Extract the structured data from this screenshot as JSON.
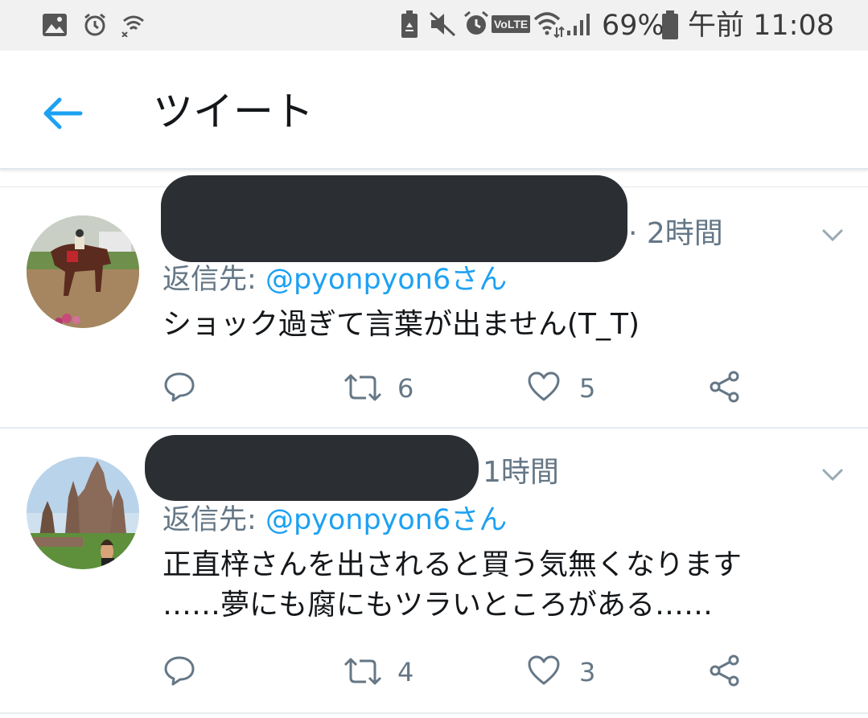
{
  "status_bar": {
    "left_icons": [
      "image-icon",
      "alarm-icon",
      "wifi-off-icon"
    ],
    "right_icons": [
      "recycle-battery-icon",
      "mute-icon",
      "alarm-clock-icon",
      "volte-icon",
      "wifi-icon",
      "signal-icon",
      "battery-icon"
    ],
    "volte_label": "VoLTE",
    "battery": "69%",
    "clock": "午前 11:08"
  },
  "app_bar": {
    "back_icon": "arrow-left-icon",
    "title": "ツイート",
    "accent": "#1da1f2"
  },
  "tweets": [
    {
      "name_redacted": true,
      "time": "· 2時間",
      "reply_label": "返信先:",
      "reply_mention": "@pyonpyon6さん",
      "text": "ショック過ぎて言葉が出ません(T_T)",
      "actions": {
        "reply": "",
        "retweets": "6",
        "likes": "5"
      }
    },
    {
      "name_redacted": true,
      "time": "1時間",
      "reply_label": "返信先:",
      "reply_mention": "@pyonpyon6さん",
      "text": "正直梓さんを出されると買う気無くなります\n……夢にも腐にもツラいところがある……",
      "actions": {
        "reply": "",
        "retweets": "4",
        "likes": "3"
      }
    }
  ],
  "colors": {
    "link": "#1da1f2",
    "secondary": "#657786",
    "redaction": "#2b2f33"
  }
}
